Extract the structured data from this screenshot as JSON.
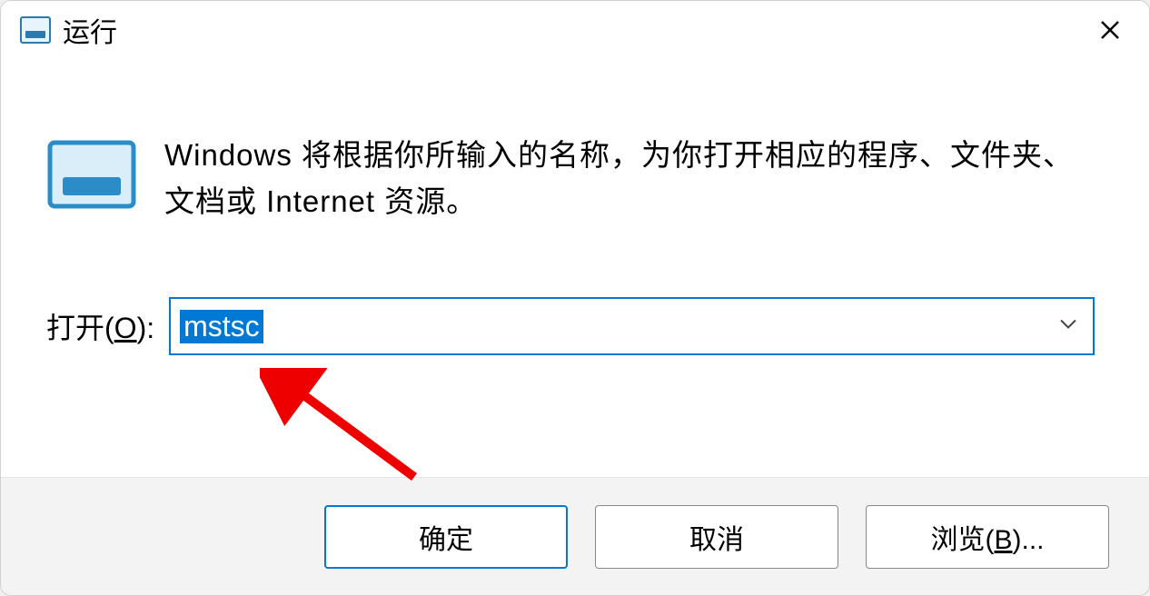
{
  "titlebar": {
    "title": "运行"
  },
  "content": {
    "description": "Windows 将根据你所输入的名称，为你打开相应的程序、文件夹、文档或 Internet 资源。",
    "open_label_prefix": "打开(",
    "open_label_accelerator": "O",
    "open_label_suffix": "):",
    "input_value": "mstsc"
  },
  "buttons": {
    "ok": "确定",
    "cancel": "取消",
    "browse_prefix": "浏览(",
    "browse_accelerator": "B",
    "browse_suffix": ")..."
  },
  "colors": {
    "accent": "#0078d4",
    "annotation_red": "#ee0000"
  }
}
